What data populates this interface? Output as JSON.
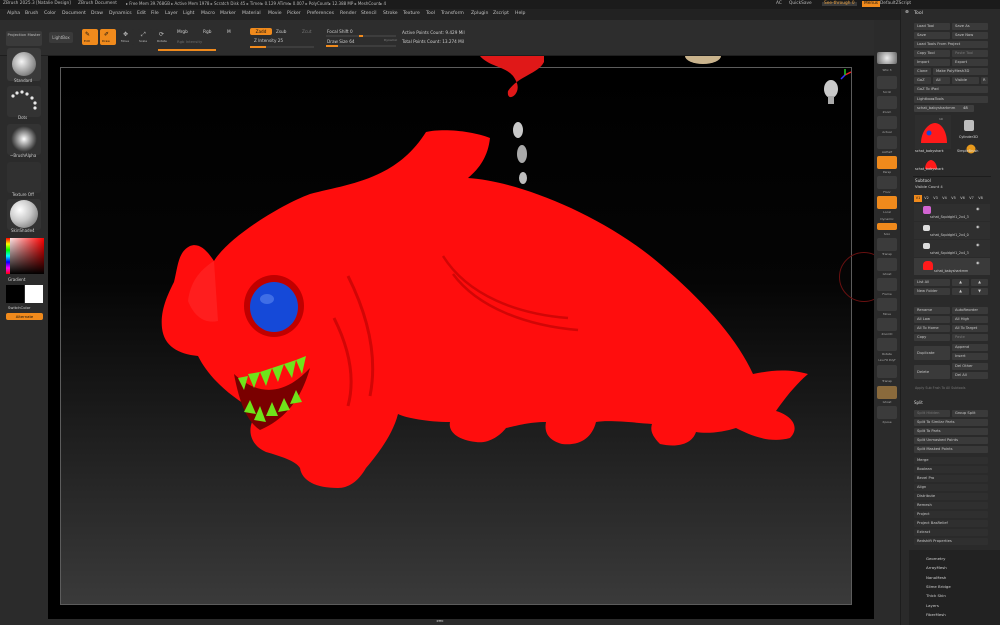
{
  "title_bar": {
    "app": "ZBrush 2025.3 [Natalie Design]",
    "doc": "ZBrush Document",
    "stats": "▸ Free Mem 39.768GB ▸ Active Mem 1978 ▸ Scratch Disk 45 ▸ Timer▸ 0.129 ATime▸ 0.007 ▸ PolyCount▸ 12.388 MP ▸ MeshCount▸ 4",
    "ac": "AC",
    "quicksave": "QuickSave",
    "seethrough": "See-through  0",
    "menus": "Menus",
    "script": "DefaultZScript"
  },
  "menubar": [
    "Alpha",
    "Brush",
    "Color",
    "Document",
    "Draw",
    "Dynamics",
    "Edit",
    "File",
    "Layer",
    "Light",
    "Macro",
    "Marker",
    "Material",
    "Movie",
    "Picker",
    "Preferences",
    "Render",
    "Stencil",
    "Stroke",
    "Texture",
    "Tool",
    "Transform",
    "Zplugin",
    "Zscript",
    "Help"
  ],
  "top_shelf": {
    "projection_master": "Projection Master",
    "lightbox": "LightBox",
    "edit": "Edit",
    "draw": "Draw",
    "move": "Move",
    "scale": "Scale",
    "rotate": "Rotate",
    "mrgb": "Mrgb",
    "rgb": "Rgb",
    "m": "M",
    "rgb_intensity": "Rgb Intensity",
    "zadd": "Zadd",
    "zsub": "Zsub",
    "zcut": "Zcut",
    "z_intensity": "Z Intensity 25",
    "focal_shift": "Focal Shift 0",
    "draw_size": "Draw Size 64",
    "dynamic": "Dynamic",
    "active_points": "Active Points Count: 9.429 Mil",
    "total_points": "Total Points Count: 13.274 Mil"
  },
  "left_shelf": {
    "brush": "Standard",
    "stroke": "Dots",
    "alpha": "~BrushAlpha",
    "texture": "Texture Off",
    "material": "SkinShade4",
    "gradient": "Gradient",
    "switch_color": "SwitchColor",
    "alternate": "Alternate"
  },
  "right_shelf": [
    "SPix 3",
    "Scroll",
    "Zoom",
    "Actual",
    "AAHalf",
    "Persp",
    "Floor",
    "Local",
    "Dynamic",
    "Solo",
    "Transp",
    "Ghost",
    "Frame",
    "Move",
    "ZoomD",
    "Rotate",
    "Line Fill PolyF",
    "Transp",
    "Ghost",
    "Xpose"
  ],
  "palette": {
    "title": "Tool",
    "buttons_row1": [
      "Load Tool",
      "Save As"
    ],
    "buttons_row2": [
      "Save",
      "Save Now"
    ],
    "load_from_project": "Load Tools From Project",
    "copy_tool": "Copy Tool",
    "paste_tool": "Paste Tool",
    "import": "Import",
    "export": "Export",
    "clone": "Clone",
    "make_polymesh": "Make PolyMesh3D",
    "goz": "GoZ",
    "all": "All",
    "visible": "Visible",
    "r": "R",
    "goz_ipad": "GoZ To iPad",
    "lightbox_tools": "Lightbox▸Tools",
    "tool_name": "schat_babysharkmm",
    "tool_name_num": "48",
    "thumb1": "schat_babyshark",
    "thumb2": "SimpleBrush",
    "thumb3": "schat_babyshark",
    "cylinder": "Cylinder3D",
    "thumb_count": "10",
    "subtool": "Subtool",
    "visible_count": "Visible Count 4",
    "v_tabs": [
      "V1",
      "V2",
      "V3",
      "V4",
      "V5",
      "V6",
      "V7",
      "V8"
    ],
    "subtools": [
      "schat_Squidgirl1_2x4_3",
      "schat_Squidgirl1_2x4_0",
      "schat_Squidgirl1_2x4_3",
      "schat_babysharkmm"
    ],
    "list_all": "List All",
    "new_folder": "New Folder",
    "rename": "Rename",
    "autoreorder": "AutoReorder",
    "all_low": "All Low",
    "all_high": "All High",
    "all_home": "All To Home",
    "all_target": "All To Target",
    "copy": "Copy",
    "paste": "Paste",
    "duplicate": "Duplicate",
    "append": "Append",
    "insert": "Insert",
    "delete": "Delete",
    "del_other": "Del Other",
    "del_all": "Del All",
    "apply_subdiv": "Apply Sub Fnsh To All Subtools",
    "split": "Split",
    "split_hidden": "Split Hidden",
    "group_split": "Group Split",
    "split_similar": "Split To Similar Parts",
    "split_parts": "Split To Parts",
    "split_unmasked": "Split Unmasked Points",
    "split_masked": "Split Masked Points",
    "merge": "Merge",
    "boolean": "Boolean",
    "bevelpro": "Bevel Pro",
    "align": "Align",
    "distribute": "Distribute",
    "remesh": "Remesh",
    "project": "Project",
    "project_basrelief": "Project BasRelief",
    "extract": "Extract",
    "redshift": "Redshift Properties",
    "sections": [
      "Geometry",
      "ArrayMesh",
      "NanoMesh",
      "Slime Bridge",
      "Thick Skin",
      "Layers",
      "FiberMesh"
    ]
  },
  "colors": {
    "accent": "#f08a1c",
    "shark": "#ff0d0d",
    "eye": "#1549d8",
    "teeth": "#6fe31a"
  }
}
